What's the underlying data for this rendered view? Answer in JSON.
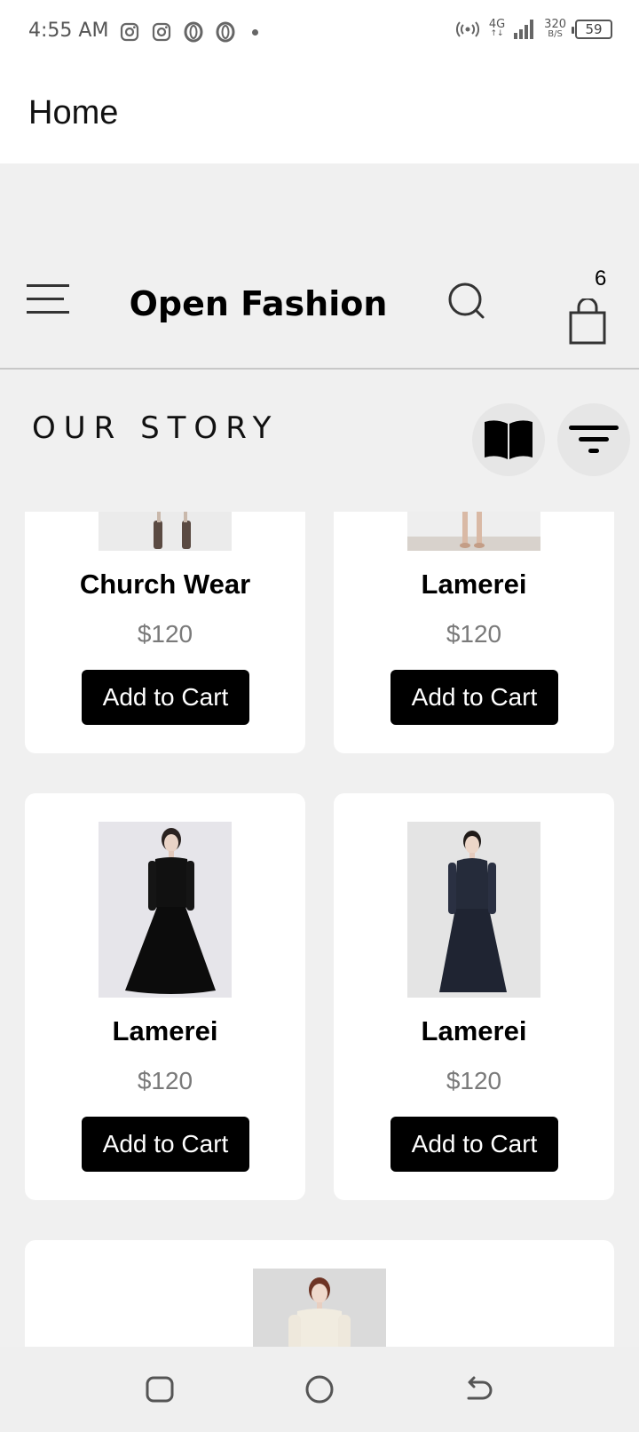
{
  "status_bar": {
    "time": "4:55 AM",
    "network_top": "4G",
    "network_speed_value": "320",
    "network_speed_unit": "B/S",
    "battery": "59"
  },
  "app_bar": {
    "title": "Home"
  },
  "header": {
    "brand": "Open Fashion",
    "cart_count": "6"
  },
  "section": {
    "title": "OUR STORY"
  },
  "products": [
    {
      "name": "Church Wear",
      "price": "$120",
      "button": "Add to Cart"
    },
    {
      "name": "Lamerei",
      "price": "$120",
      "button": "Add to Cart"
    },
    {
      "name": "Lamerei",
      "price": "$120",
      "button": "Add to Cart"
    },
    {
      "name": "Lamerei",
      "price": "$120",
      "button": "Add to Cart"
    }
  ]
}
